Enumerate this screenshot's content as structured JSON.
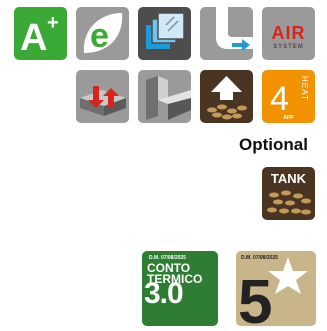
{
  "badges": {
    "energy_class": "A",
    "energy_class_sup": "+",
    "eco_letter": "e",
    "air_system_title": "AIR",
    "air_system_sub": "SYSTEM",
    "heat_app_number": "4",
    "heat_app_word": "HEAT",
    "heat_app_sub": "APP",
    "tank_label": "TANK"
  },
  "optional_label": "Optional",
  "conto_termico": {
    "decree": "D.M. 07/08/2025",
    "line1": "CONTO",
    "line2": "TERMICO",
    "version": "3.0"
  },
  "five_star": {
    "decree": "D.M. 07/08/2025",
    "number": "5"
  },
  "colors": {
    "green": "#3aa935",
    "dark_green": "#2e7d32",
    "grey": "#9a9a9a",
    "dark_grey": "#4d4d4d",
    "blue": "#1e9bd7",
    "red": "#d9241c",
    "brown": "#4a3523",
    "orange": "#f39200",
    "gold": "#c9b58a"
  }
}
